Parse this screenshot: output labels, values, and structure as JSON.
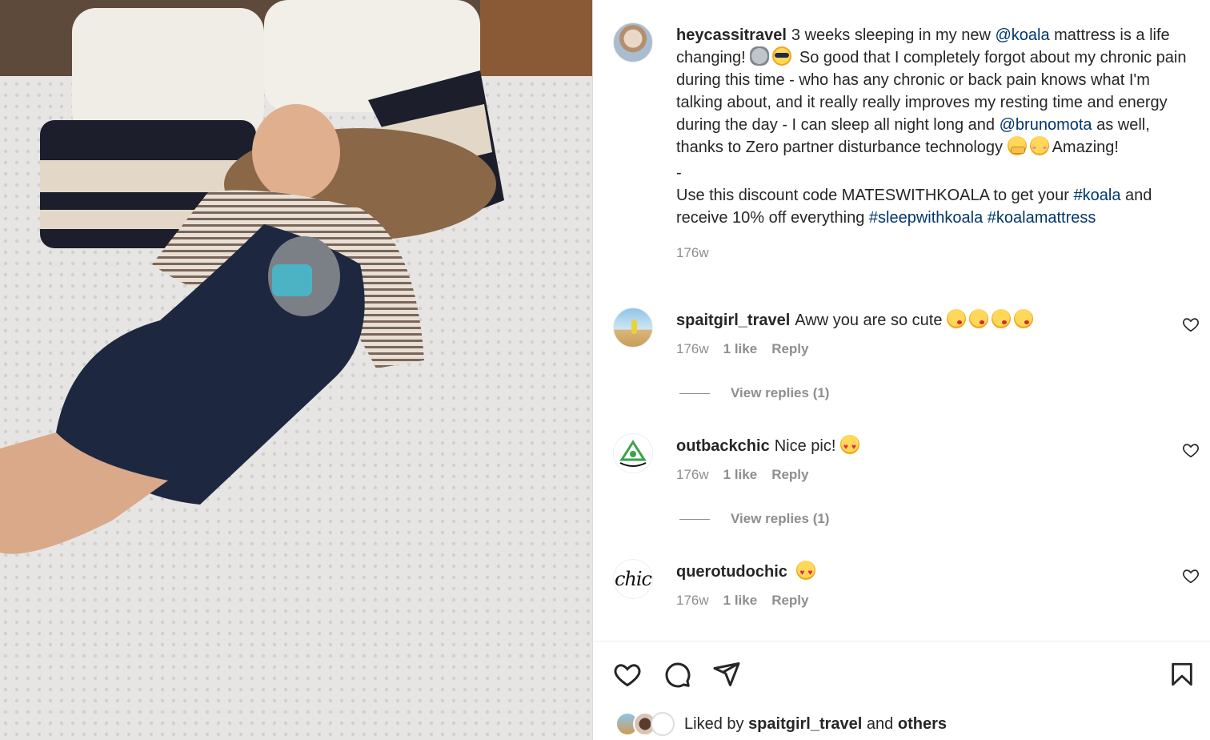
{
  "post": {
    "author": "heycassitravel",
    "caption_part1": "3 weeks sleeping in my new ",
    "mention_koala": "@koala",
    "caption_part2": " mattress is a life changing! ",
    "caption_part3": " So good that I completely forgot about my chronic pain during this time - who has any chronic or back pain knows what I'm talking about, and it really really improves my resting time and energy during the day - I can sleep all night long and ",
    "mention_bruno": "@brunomota",
    "caption_part4": " as well, thanks to Zero partner disturbance technology ",
    "caption_part5": "Amazing!",
    "separator": "-",
    "discount_text": "Use this discount code MATESWITHKOALA to get your ",
    "hashtag_koala": "#koala",
    "discount_text2": " and receive 10% off everything ",
    "hashtag_sleep": "#sleepwithkoala",
    "hashtag_mattress": "#koalamattress",
    "time": "176w"
  },
  "comments": [
    {
      "username": "spaitgirl_travel",
      "text": "Aww you are so cute",
      "time": "176w",
      "likes": "1 like",
      "reply": "Reply",
      "view_replies": "View replies (1)"
    },
    {
      "username": "outbackchic",
      "text": "Nice pic!",
      "time": "176w",
      "likes": "1 like",
      "reply": "Reply",
      "view_replies": "View replies (1)"
    },
    {
      "username": "querotudochic",
      "text": "",
      "avatar_text": "chic",
      "time": "176w",
      "likes": "1 like",
      "reply": "Reply"
    }
  ],
  "footer": {
    "liked_prefix": "Liked by ",
    "liked_user": "spaitgirl_travel",
    "liked_mid": " and ",
    "liked_others": "others"
  },
  "icons": {
    "like": "heart-icon",
    "comment": "comment-icon",
    "share": "share-icon",
    "save": "bookmark-icon"
  }
}
